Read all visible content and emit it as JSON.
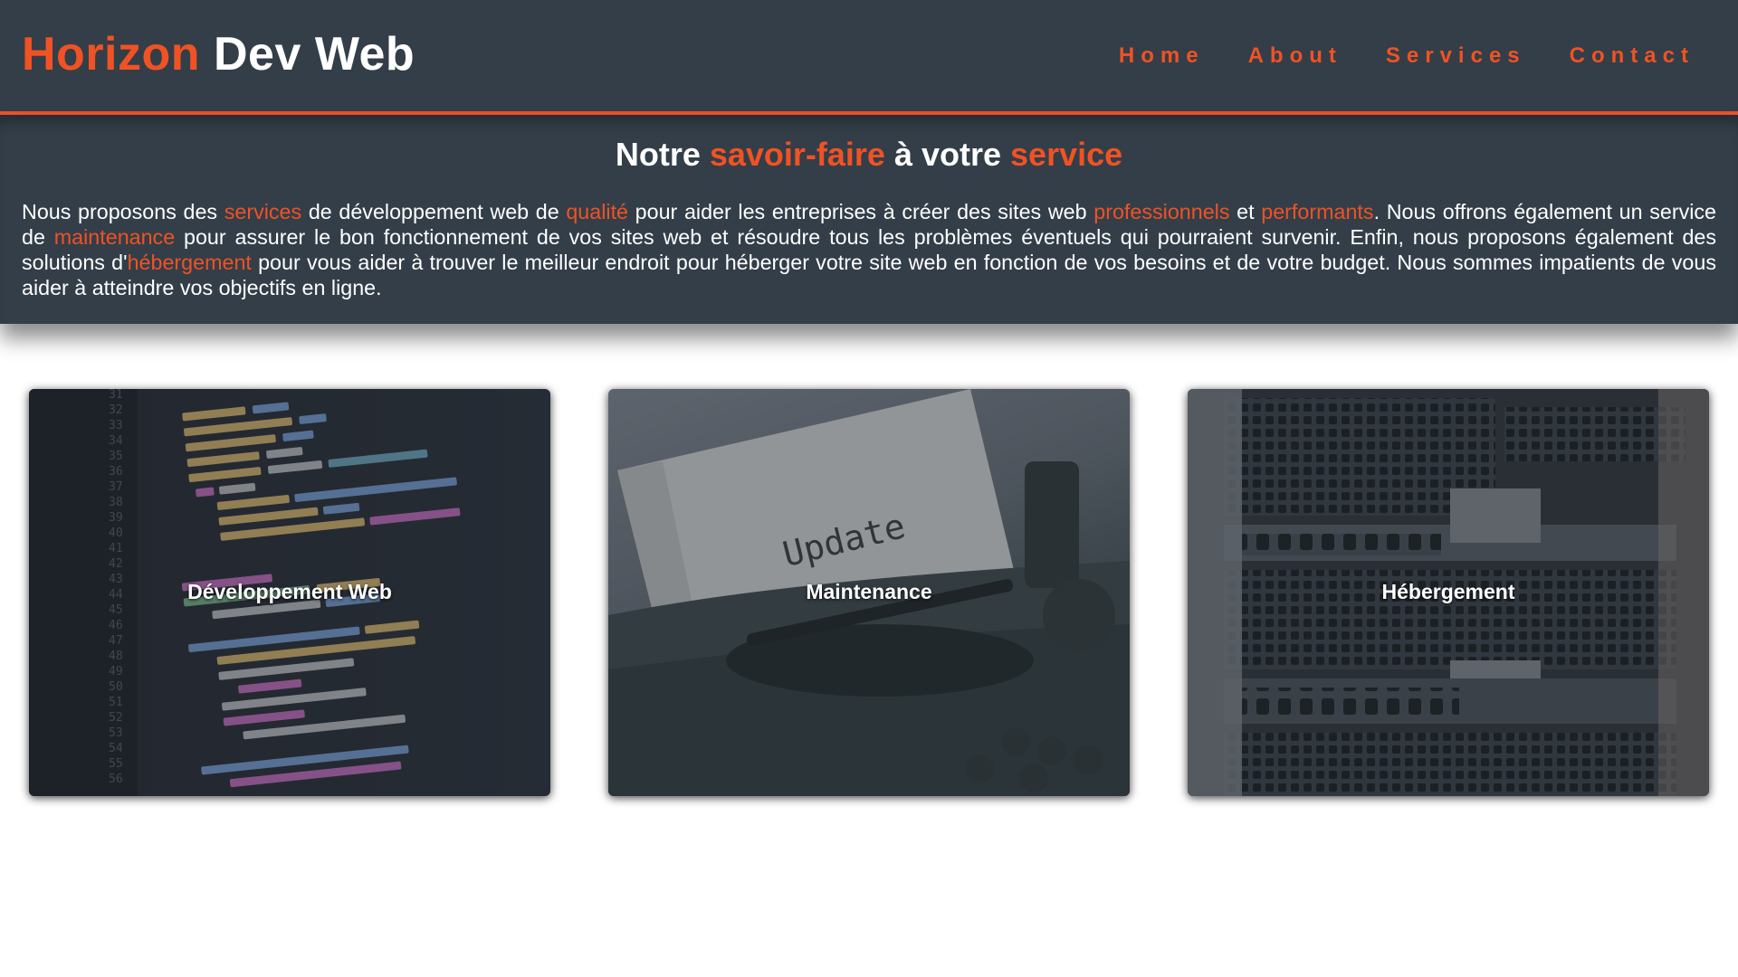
{
  "header": {
    "logo_accent": "Horizon",
    "logo_rest": " Dev Web",
    "nav": [
      {
        "label": "Home"
      },
      {
        "label": "About"
      },
      {
        "label": "Services"
      },
      {
        "label": "Contact"
      }
    ]
  },
  "intro": {
    "heading": {
      "part1": "Notre ",
      "part2": "savoir-faire",
      "part3": " à votre ",
      "part4": "service"
    },
    "paragraph": {
      "t1": "Nous proposons des ",
      "a1": "services",
      "t2": " de développement web de ",
      "a2": "qualité",
      "t3": " pour aider les entreprises à créer des sites web ",
      "a3": "professionnels",
      "t4": " et ",
      "a4": "performants",
      "t5": ". Nous offrons également un service de ",
      "a5": "maintenance",
      "t6": " pour assurer le bon fonctionnement de vos sites web et résoudre tous les problèmes éventuels qui pourraient survenir. Enfin, nous proposons également des solutions d'",
      "a6": "hébergement",
      "t7": " pour vous aider à trouver le meilleur endroit pour héberger votre site web en fonction de vos besoins et de votre budget. Nous sommes impatients de vous aider à atteindre vos objectifs en ligne."
    }
  },
  "cards": [
    {
      "title": "Développement Web",
      "image": "code-editor-image"
    },
    {
      "title": "Maintenance",
      "image": "typewriter-update-image"
    },
    {
      "title": "Hébergement",
      "image": "server-rack-image"
    }
  ],
  "colors": {
    "accent": "#f05224",
    "header_bg": "#333e48",
    "text": "#ffffff"
  }
}
